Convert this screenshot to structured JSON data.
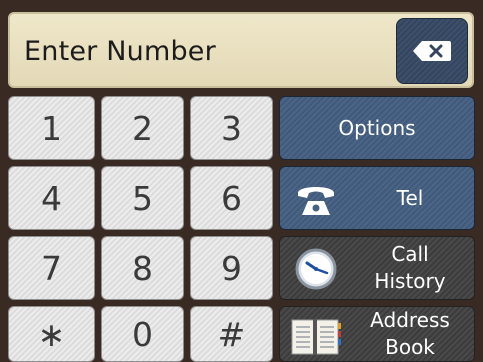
{
  "display": {
    "text": "Enter Number"
  },
  "keypad": {
    "keys": [
      "1",
      "2",
      "3",
      "4",
      "5",
      "6",
      "7",
      "8",
      "9",
      "∗",
      "0",
      "#"
    ]
  },
  "functions": {
    "options": {
      "label": "Options"
    },
    "tel": {
      "label": "Tel"
    },
    "call_history": {
      "line1": "Call",
      "line2": "History"
    },
    "address_book": {
      "line1": "Address",
      "line2": "Book"
    }
  },
  "icons": {
    "backspace": "backspace-icon",
    "tel": "phone-icon",
    "call_history": "clock-icon",
    "address_book": "address-book-icon"
  },
  "colors": {
    "display_bg": "#e8dfc0",
    "key_bg": "#e4e4e4",
    "function_blue": "#46607f",
    "function_dark": "#434343",
    "background": "#3a2a24"
  }
}
